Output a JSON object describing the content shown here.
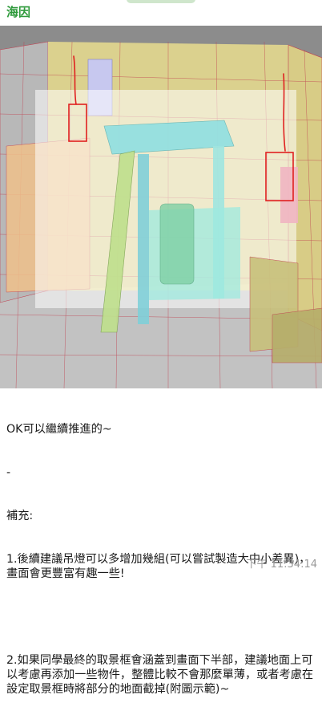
{
  "chat": {
    "sender_name": "海因",
    "message_lines": [
      "OK可以繼續推進的~",
      "-",
      "補充:",
      "1.後續建議吊燈可以多增加幾組(可以嘗試製造大中小差異)，畫面會更豐富有趣一些!",
      "",
      "2.如果同學最終的取景框會涵蓋到畫面下半部，建議地面上可以考慮再添加一些物件，整體比較不會那麼單薄，或者考慮在設定取景框時將部分的地面截掉(附圖示範)~"
    ],
    "timestamp": "下午 11:34:14"
  },
  "image": {
    "kind": "3d-room-render-with-red-annotations",
    "colors": {
      "background": "#8c8c8c",
      "floor": "#bdbdbd",
      "frame": "#ffffff",
      "yellow": "#e8dc8a",
      "cyan": "#8fe3e0",
      "orange": "#f1c38f",
      "green": "#b9df8a",
      "olive": "#c9c27a",
      "lavender": "#c9c9ef",
      "pink": "#f2b8c4",
      "annotation_red": "#e02020"
    }
  }
}
